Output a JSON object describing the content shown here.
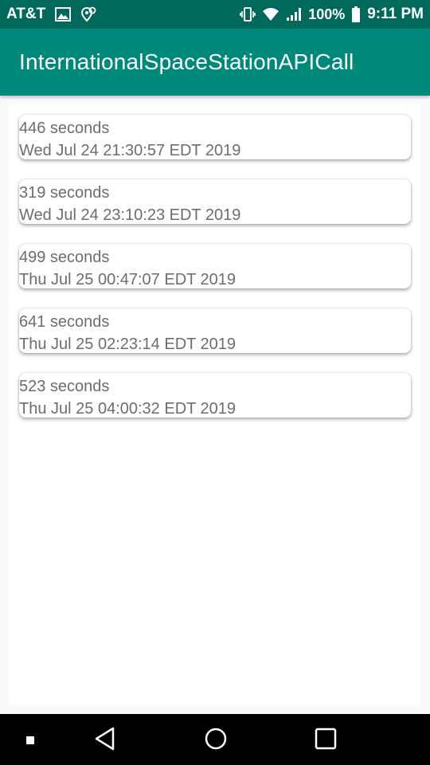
{
  "status_bar": {
    "carrier": "AT&T",
    "left_icons": [
      "image-icon",
      "location-settings-icon"
    ],
    "right_icons": [
      "vibrate-icon",
      "wifi-icon",
      "signal-icon",
      "battery-icon"
    ],
    "battery_percent": "100%",
    "time": "9:11 PM"
  },
  "app_bar": {
    "title": "InternationalSpaceStationAPICall",
    "color": "#00897b"
  },
  "passes": [
    {
      "duration": "446 seconds",
      "datetime": "Wed Jul 24 21:30:57 EDT 2019"
    },
    {
      "duration": "319 seconds",
      "datetime": "Wed Jul 24 23:10:23 EDT 2019"
    },
    {
      "duration": "499 seconds",
      "datetime": "Thu Jul 25 00:47:07 EDT 2019"
    },
    {
      "duration": "641 seconds",
      "datetime": "Thu Jul 25 02:23:14 EDT 2019"
    },
    {
      "duration": "523 seconds",
      "datetime": "Thu Jul 25 04:00:32 EDT 2019"
    }
  ],
  "nav_bar": {
    "buttons": [
      "recents-dot-icon",
      "back-icon",
      "home-icon",
      "overview-icon"
    ]
  }
}
